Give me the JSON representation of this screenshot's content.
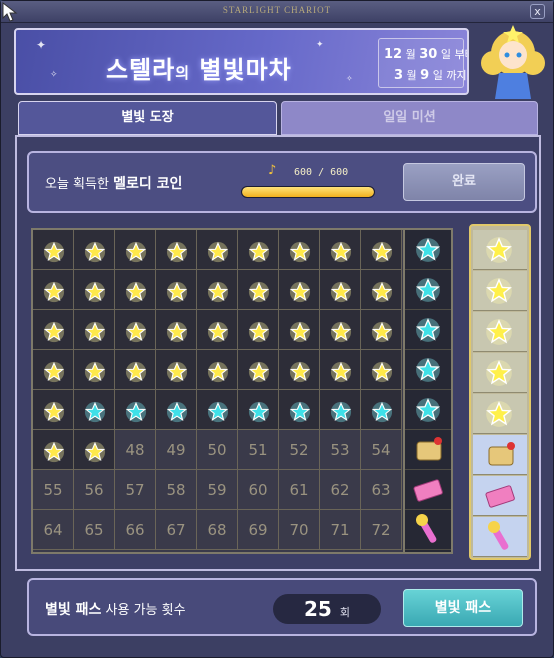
{
  "window": {
    "title": "STARLIGHT CHARIOT",
    "close_label": "x"
  },
  "header": {
    "title_main_1": "스텔라",
    "title_particle": "의",
    "title_main_2": "별빛마차",
    "date_start_month": "12",
    "date_start_day": "30",
    "date_start_suffix": "부터",
    "date_end_month": "3",
    "date_end_day": "9",
    "date_end_suffix": "까지",
    "month_unit": "월",
    "day_unit": "일"
  },
  "tabs": [
    {
      "label": "별빛 도장",
      "active": true
    },
    {
      "label": "일일 미션",
      "active": false
    }
  ],
  "coin": {
    "label_prefix": "오늘 획득한 ",
    "label_bold": "멜로디 코인",
    "counter": "600 / 600",
    "progress": 1.0,
    "done_label": "완료"
  },
  "stamp_grid": {
    "columns": 9,
    "rows": 8,
    "collected": 47,
    "numbers": [
      "48",
      "49",
      "50",
      "51",
      "52",
      "53",
      "54",
      "55",
      "56",
      "57",
      "58",
      "59",
      "60",
      "61",
      "62",
      "63",
      "64",
      "65",
      "66",
      "67",
      "68",
      "69",
      "70",
      "71",
      "72"
    ]
  },
  "bottom": {
    "label_bold": "별빛 패스",
    "label_rest": " 사용 가능 횟수",
    "count": "25",
    "count_unit": "회",
    "pass_button": "별빛 패스"
  },
  "colors": {
    "gold_star": "#ffe94a",
    "cyan_star": "#3fe0e8",
    "panel": "#3d3f66",
    "button_teal": "#4bbcc4"
  }
}
